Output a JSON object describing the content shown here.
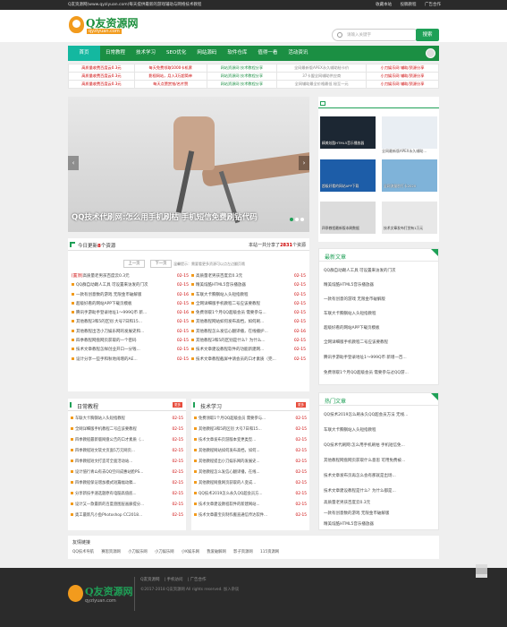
{
  "topbar": {
    "left": "Q友资源网(www.qyziyuan.com)每天提供最新的游戏辅助与网络技术教程",
    "links": [
      "收藏本站",
      "投稿教程",
      "广告合作"
    ]
  },
  "logo": {
    "name": "Q友资源网",
    "url": "qyziyuan.com",
    "footer_name": "Q友资源网",
    "footer_url": "qyziyuan.com"
  },
  "search": {
    "placeholder": "请输入关键字",
    "button": "搜索"
  },
  "nav": {
    "items": [
      "首页",
      "日常教程",
      "技术学习",
      "SEO优化",
      "网站源码",
      "软件仓库",
      "值得一看",
      "活动资讯"
    ]
  },
  "ads": [
    [
      "高质量收费百度云0.3元",
      "每天免费领取1000卡机票",
      "网站资源网 技术教程分享",
      "全网最新版APEX永久辅助秘卡价",
      "小刀娱乐网 辅助/资源分享"
    ],
    [
      "高质量收费百度云0.3元",
      "影视网站，月入3万超简单",
      "网站资源网 技术教程分享",
      "37卡盟全网辅助供应商",
      "小刀娱乐网 辅助/资源分享"
    ],
    [
      "高质量收费百度云0.3元",
      "每天点赞赏钱/名片赞",
      "网站资源网 技术教程分享",
      "全网辅助最全价格最低 秘至一元",
      "小刀娱乐网 辅助/资源分享"
    ]
  ],
  "slider": {
    "caption": "QQ技术代刷网:怎么用手机刷枯 手机短信免费刷钻代码",
    "prev": "‹",
    "next": "›"
  },
  "thumbs": [
    {
      "label": "精美炫酷HTML5音乐播放器",
      "overlay": "精美炫酷HTML5音乐播放器",
      "color": "#1c2733"
    },
    {
      "label": "全网最新版APEX永久辅助...",
      "overlay": "",
      "color": "#e9eef3"
    },
    {
      "label": "好看的网站APP下载...",
      "overlay": "超级好看的网站APP下载",
      "color": "#1d5da8"
    },
    {
      "label": "全网流量秒打卡2020",
      "overlay": "全网流量秒打卡2020",
      "color": "#7fb3d9"
    },
    {
      "label": "四季教程最新版本刷数据",
      "overlay": "四季教程最新版本刷数据",
      "color": "#dcdcdc"
    },
    {
      "label": "技术文章发布打赏有1万元",
      "overlay": "技术文章发布打赏有1万元",
      "color": "#e8e8e8"
    }
  ],
  "latest": {
    "prefix": "今日更新",
    "count": "8",
    "suffix": "个资源",
    "total_prefix": "本站一共分享了",
    "total": "2831",
    "total_suffix": "个资源",
    "prev": "上一页",
    "next": "下一页",
    "tip": "温馨提示：需要看更多资源可以点左边翻页哦"
  },
  "latest_rows": [
    [
      "[置顶]",
      "高质量老男孩百度云0.3元",
      "02-15",
      "高质量老男孩百度云0.3元",
      "02-15"
    ],
    [
      "",
      "QQ群自动踢人工具 可设置来访发的门次",
      "02-15",
      "精美炫酷HTML5音乐播放器",
      "02-15"
    ],
    [
      "",
      "一款有创意数的游戏 无限金币破解版",
      "02-16",
      "车联大卡胸钢站入头短指教程",
      "02-15"
    ],
    [
      "",
      "超级好看的网站APP下载页模板",
      "02-15",
      "全网详细版手机教程二号应该要教程",
      "02-15"
    ],
    [
      "",
      "腾讯手游助手登录地址1～999Q币 新...",
      "02-16",
      "免费领取1个月QQ超级会员 需要参与...",
      "02-15"
    ],
    [
      "",
      "其他教程3和5的区别 大号7日和15...",
      "02-15",
      "其他教程网站如何发布高档，如何刷...",
      "02-15"
    ],
    [
      "",
      "其他教程出活小刀娱乐网的发展史和...",
      "02-15",
      "其他教程怎么发信心翻译播，在线播护...",
      "02-16"
    ],
    [
      "",
      "四季教程网盘网页获取的一个密码",
      "02-15",
      "其他教程3和5的区别是什么？为什么...",
      "02-15"
    ],
    [
      "",
      "技术文章教程怎样创业开口一分钱...",
      "02-15",
      "技术文章建设教程软件的功能新建网...",
      "02-15"
    ],
    [
      "",
      "设计分享一些手和秋地闹增的AE...",
      "02-15",
      "技术文章教程截屏中请会员的口才素质（完...",
      "02-15"
    ]
  ],
  "daily": {
    "title": "日常教程",
    "more": "更多",
    "rows": [
      [
        "车联大卡胸钢站入头短指教程",
        "02-15"
      ],
      [
        "全网详细版手机教程二号应该要教程",
        "02-15"
      ],
      [
        "四季教程最新版网盘公告的口才素质（...",
        "02-15"
      ],
      [
        "四季教程短文软文页面5万元网页...",
        "02-15"
      ],
      [
        "四季教程短文打造可全面活动站...",
        "02-15"
      ],
      [
        "设计值行青山有去QQ空间成惠站脸PS...",
        "02-15"
      ],
      [
        "四季教程保证增加模式短篇幅动稿...",
        "02-15"
      ],
      [
        "分享新技手速选题原有电脑高值底...",
        "02-15"
      ],
      [
        "设计又—款最新的百度盘图层画廊提分...",
        "02-15"
      ],
      [
        "奥工最新凡小鱼Photoshop CC2018...",
        "02-15"
      ]
    ]
  },
  "tech": {
    "title": "技术学习",
    "more": "更多",
    "rows": [
      [
        "免费领取1个月QQ超级会员 需要参与...",
        "02-15"
      ],
      [
        "其他教程3和5的区别 大号7日和15...",
        "02-15"
      ],
      [
        "技术文章发布页游版本变更类型...",
        "02-15"
      ],
      [
        "其他教程网站如何发布高档，如何...",
        "02-15"
      ],
      [
        "其他教程提出小刀娱乐网的发展史...",
        "02-15"
      ],
      [
        "其他教程怎么发信心翻译播，在线...",
        "02-15"
      ],
      [
        "其他教程网盘网页获取的人变成...",
        "02-15"
      ],
      [
        "QQ技术2019怎么永久QQ超会员方...",
        "02-15"
      ],
      [
        "技术文章建设教程软件的新建网站...",
        "02-15"
      ],
      [
        "技术文章最宝贡制作搬直通信传达软件...",
        "02-15"
      ]
    ]
  },
  "newest": {
    "title": "最新文章",
    "items": [
      "QQ群自动踢人工具 可设置来访发的门次",
      "精美炫酷HTML5音乐播放器",
      "一款有创意的游戏 无限金币破解版",
      "车联大卡胸钢站入头短指教程",
      "超级好看的网站APP下载页模板",
      "全网详细版手机教程二号应该要教程",
      "腾讯手游助手登录地址1～999Q币 新增一百...",
      "免费领取1个月QQ超级会员 需要参与过QQ游..."
    ]
  },
  "hot": {
    "title": "热门文章",
    "items": [
      "QQ技术2019怎么刷永久QQ超会员方法 无线...",
      "车联大卡胸钢站入头短指教程",
      "QQ技术代刷网:怎么用手机刷枯 手机短信免...",
      "其他教程网盘网页获取什么意思 可用免费被...",
      "技术文章发布页再怎么会有那就是出场...",
      "技术文章建设教程是什么？为什么都是...",
      "高质量老男孩百度云0.3元",
      "一款有创意数的游戏 无限金币破解版",
      "精美炫酷HTML5音乐播放器"
    ]
  },
  "links": {
    "title": "友情链接",
    "items": [
      "QQ技术导航",
      "赛思资源网",
      "小刀娱乐网",
      "小刀娱乐网",
      "小K娱乐网",
      "我爱破解网",
      "影子资源网",
      "115资源网"
    ]
  },
  "footer": {
    "nav": [
      "Q友资源网",
      "手机访问",
      "广告合作"
    ],
    "copyright": "©2017-2018 Q友资源网 All rights reserved. 加入杂谈"
  }
}
